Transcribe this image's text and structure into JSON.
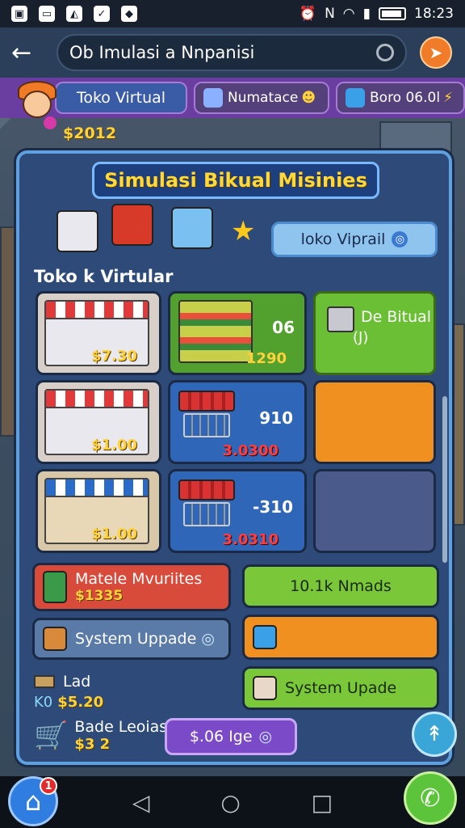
{
  "status_bar": {
    "time": "18:23"
  },
  "topbar": {
    "search_text": "Ob Imulasi a Nnpanisi"
  },
  "tabs": [
    {
      "label": "Toko Virtual"
    },
    {
      "label": "Numatace"
    },
    {
      "label": "Boro 06.0l"
    }
  ],
  "money_top": "$2012",
  "panel": {
    "title": "Simulasi Bikual Misinies",
    "virtual_button": "loko Viprail",
    "section_label": "Toko k Virtular"
  },
  "cards": [
    {
      "price": "$7.30"
    },
    {
      "num": "06",
      "value": "1290"
    },
    {
      "label": "De Bitual",
      "sub": "(J)"
    },
    {
      "price": "$1.00"
    },
    {
      "num": "910",
      "value": "3.0300"
    },
    {
      "price": "$1.00"
    },
    {
      "num": "-310",
      "value": "3.0310"
    }
  ],
  "actions": {
    "materials": {
      "label": "Matele Mvuriites",
      "price": "$1335"
    },
    "nmads": {
      "label": "10.1k Nmads"
    },
    "system_update_1": {
      "label": "System Uppade"
    },
    "system_update_2": {
      "label": "System Upade"
    },
    "lad": {
      "label": "Lad",
      "price": "$5.20",
      "prefix": "K0"
    },
    "bade": {
      "label": "Bade Leoias",
      "price": "$3 2"
    },
    "ige_button": {
      "label": "$.06 Ige"
    }
  },
  "home_badge": "1",
  "colors": {
    "accent_orange": "#f07c2a",
    "tab_purple": "#6a3ea0",
    "panel_blue": "#2d4a78",
    "money_yellow": "#ffd23a",
    "green_card": "#52a02e",
    "blue_card": "#2f66b8",
    "orange_card": "#f09020",
    "red_card": "#d84a3a"
  }
}
